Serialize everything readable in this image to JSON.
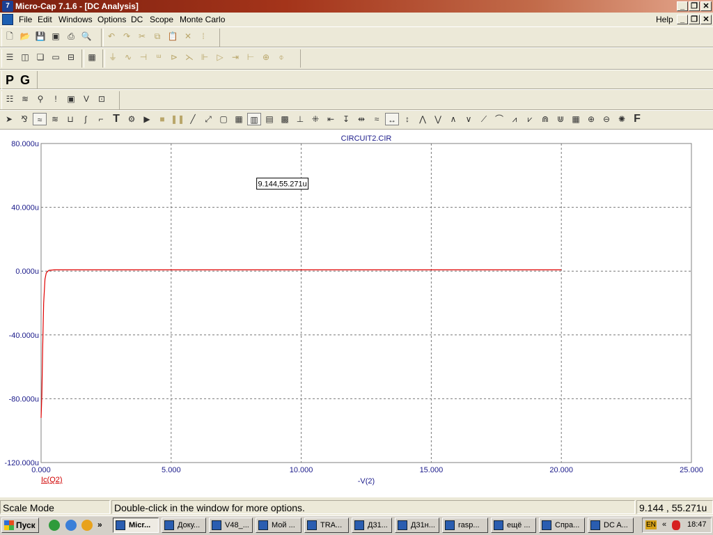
{
  "window": {
    "title": "Micro-Cap 7.1.6 - [DC Analysis]",
    "app_icon_text": "7"
  },
  "menu": {
    "items": [
      "File",
      "Edit",
      "Windows",
      "Options",
      "DC",
      "Scope",
      "Monte Carlo"
    ],
    "help": "Help"
  },
  "toolbar": {
    "p_label": "P",
    "g_label": "G"
  },
  "chart_data": {
    "type": "line",
    "title": "CIRCUIT2.CIR",
    "xlabel": "-V(2)",
    "series_label": "Ic(Q2)",
    "xlim": [
      0,
      25
    ],
    "ylim": [
      -120,
      80
    ],
    "x_ticks": [
      "0.000",
      "5.000",
      "10.000",
      "15.000",
      "20.000",
      "25.000"
    ],
    "y_ticks": [
      "80.000u",
      "40.000u",
      "0.000u",
      "-40.000u",
      "-80.000u",
      "-120.000u"
    ],
    "grid": "dashed",
    "series": [
      {
        "name": "Ic(Q2)",
        "color": "#e00000",
        "x": [
          0,
          0.03,
          0.06,
          0.1,
          0.15,
          0.2,
          0.3,
          0.5,
          1,
          5,
          10,
          15,
          20
        ],
        "y": [
          -92,
          -78,
          -50,
          -20,
          -5,
          -1,
          0.5,
          0.8,
          0.8,
          0.8,
          0.8,
          0.8,
          0.8
        ]
      }
    ],
    "annotation": "9.144,55.271u"
  },
  "status": {
    "mode": "Scale Mode",
    "hint": "Double-click in the window for more options.",
    "coords": "9.144 , 55.271u"
  },
  "taskbar": {
    "start": "Пуск",
    "tasks": [
      "Micr...",
      "Доку...",
      "V48_...",
      "Мой ...",
      "TRA...",
      "Д31...",
      "Д31н...",
      "rasp...",
      "ещё ...",
      "Спра...",
      "DC A..."
    ],
    "lang": "EN",
    "clock": "18:47"
  }
}
